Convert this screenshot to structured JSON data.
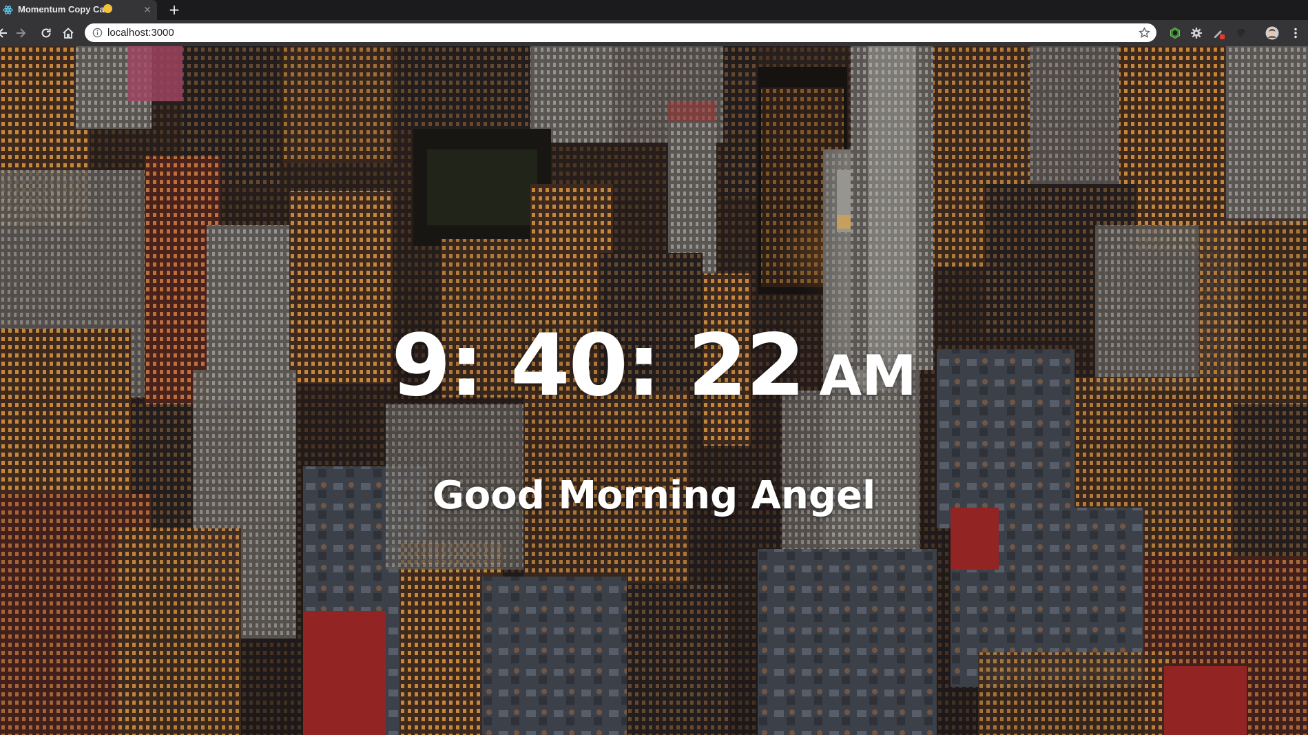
{
  "browser": {
    "tab": {
      "title": "Momentum Copy Cat",
      "emoji_icon": "smiling-face-icon"
    },
    "address_bar": {
      "url": "localhost:3000"
    },
    "toolbar": {
      "back_icon": "arrow-left-icon",
      "forward_icon": "arrow-right-icon",
      "reload_icon": "reload-icon",
      "home_icon": "home-icon",
      "info_icon": "info-icon",
      "bookmark_icon": "star-icon"
    },
    "extensions": [
      "hexagon-extension-icon",
      "gear-extension-icon",
      "pen-extension-icon",
      "dark-extension-icon",
      "avatar",
      "more-vert-icon"
    ]
  },
  "app": {
    "clock": {
      "time": "9: 40: 22",
      "period": "AM"
    },
    "greeting": "Good Morning Angel"
  },
  "colors": {
    "tabstrip": "#1b1b1d",
    "toolbar": "#353538",
    "text": "#ffffff"
  }
}
